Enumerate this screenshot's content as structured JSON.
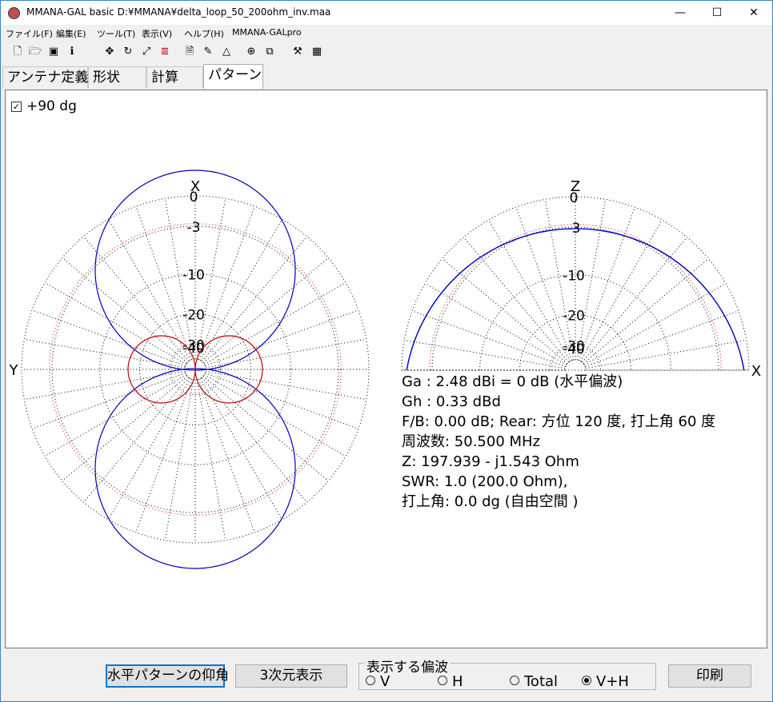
{
  "window": {
    "title": "MMANA-GAL basic D:¥MMANA¥delta_loop_50_200ohm_inv.maa",
    "minimize": "—",
    "maximize": "☐",
    "close": "✕"
  },
  "menu": [
    "ファイル(F)",
    "編集(E)",
    "ツール(T)",
    "表示(V)",
    "ヘルプ(H)",
    "MMANA-GALpro"
  ],
  "toolbar_icons": [
    "new-file-icon",
    "open-folder-icon",
    "save-icon",
    "info-icon",
    "move-icon",
    "rotate-icon",
    "resize-icon",
    "split-icon",
    "document-icon",
    "pen-icon",
    "triangle-icon",
    "target-icon",
    "copy-icon",
    "tools-icon",
    "calculator-icon"
  ],
  "tabs": [
    "アンテナ定義",
    "形状",
    "計算",
    "パターン"
  ],
  "active_tab": "パターン",
  "checkbox": {
    "label": "+90 dg",
    "checked": true
  },
  "plot": {
    "horizontal": {
      "top_label": "X",
      "left_label": "Y"
    },
    "vertical": {
      "top_label": "Z",
      "right_label": "X"
    },
    "ring_labels": [
      "0",
      "-3",
      "-10",
      "-20",
      "-30",
      "-40"
    ],
    "colors": {
      "h_pattern": "#0000c0",
      "v_pattern": "#c00000",
      "grid": "#000000",
      "ref_ring": "#ff0000"
    }
  },
  "info": {
    "ga": "Ga : 2.48 dBi = 0 dB  (水平偏波)",
    "gh": "Gh : 0.33 dBd",
    "fb": "F/B: 0.00 dB; Rear: 方位 120 度,  打上角 60 度",
    "freq": "周波数: 50.500 MHz",
    "z": "Z: 197.939 - j1.543 Ohm",
    "swr": "SWR: 1.0 (200.0 Ohm),",
    "elev": "打上角: 0.0 dg (自由空間 )"
  },
  "buttons": {
    "horiz_elev": "水平パターンの仰角",
    "view3d": "3次元表示",
    "print": "印刷"
  },
  "polarization": {
    "title": "表示する偏波",
    "options": [
      "V",
      "H",
      "Total",
      "V+H"
    ],
    "selected": "V+H"
  }
}
